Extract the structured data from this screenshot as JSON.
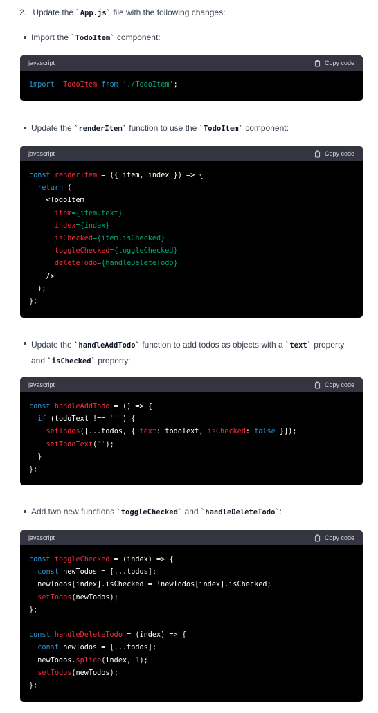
{
  "steps": {
    "step2": {
      "number": "2.",
      "text_before": "Update the ",
      "code": "`App.js`",
      "text_after": " file with the following changes:"
    }
  },
  "bullets": [
    {
      "parts": [
        "Import the ",
        "`TodoItem`",
        " component:"
      ]
    },
    {
      "parts": [
        "Update the ",
        "`renderItem`",
        " function to use the ",
        "`TodoItem`",
        " component:"
      ]
    },
    {
      "parts": [
        "Update the ",
        "`handleAddTodo`",
        " function to add todos as objects with a ",
        "`text`",
        " property"
      ],
      "line2": [
        "and ",
        "`isChecked`",
        " property:"
      ]
    },
    {
      "parts": [
        "Add two new functions ",
        "`toggleChecked`",
        " and ",
        "`handleDeleteTodo`",
        ":"
      ]
    }
  ],
  "codeblocks": [
    {
      "language": "javascript",
      "copy_label": "Copy code"
    },
    {
      "language": "javascript",
      "copy_label": "Copy code"
    },
    {
      "language": "javascript",
      "copy_label": "Copy code"
    },
    {
      "language": "javascript",
      "copy_label": "Copy code"
    }
  ],
  "code": {
    "b1": [
      [
        [
          "kw",
          "import"
        ],
        [
          "",
          "  "
        ],
        [
          "fn",
          "TodoItem"
        ],
        [
          "",
          " "
        ],
        [
          "kw",
          "from"
        ],
        [
          "",
          " "
        ],
        [
          "str",
          "'./TodoItem'"
        ],
        [
          "",
          ";"
        ]
      ]
    ],
    "b2": [
      [
        [
          "kw",
          "const"
        ],
        [
          "",
          " "
        ],
        [
          "fn",
          "renderItem"
        ],
        [
          "",
          " = ({ item, index }) => {"
        ]
      ],
      [
        [
          "",
          "  "
        ],
        [
          "kw",
          "return"
        ],
        [
          "",
          " ("
        ]
      ],
      [
        [
          "",
          "    <TodoItem"
        ]
      ],
      [
        [
          "",
          "      "
        ],
        [
          "attr",
          "item"
        ],
        [
          "jsx",
          "={item.text}"
        ]
      ],
      [
        [
          "",
          "      "
        ],
        [
          "attr",
          "index"
        ],
        [
          "jsx",
          "={index}"
        ]
      ],
      [
        [
          "",
          "      "
        ],
        [
          "attr",
          "isChecked"
        ],
        [
          "jsx",
          "={item.isChecked}"
        ]
      ],
      [
        [
          "",
          "      "
        ],
        [
          "attr",
          "toggleChecked"
        ],
        [
          "jsx",
          "={toggleChecked}"
        ]
      ],
      [
        [
          "",
          "      "
        ],
        [
          "attr",
          "deleteTodo"
        ],
        [
          "jsx",
          "={handleDeleteTodo}"
        ]
      ],
      [
        [
          "",
          "    />"
        ]
      ],
      [
        [
          "",
          "  );"
        ]
      ],
      [
        [
          "",
          "};"
        ]
      ]
    ],
    "b3": [
      [
        [
          "kw",
          "const"
        ],
        [
          "",
          " "
        ],
        [
          "fn",
          "handleAddTodo"
        ],
        [
          "",
          " = () => {"
        ]
      ],
      [
        [
          "",
          "  "
        ],
        [
          "kw",
          "if"
        ],
        [
          "",
          " (todoText !== "
        ],
        [
          "str",
          "''"
        ],
        [
          "",
          " ) {"
        ]
      ],
      [
        [
          "",
          "    "
        ],
        [
          "fn",
          "setTodos"
        ],
        [
          "",
          "([...todos, { "
        ],
        [
          "attr",
          "text"
        ],
        [
          "",
          ": todoText, "
        ],
        [
          "attr",
          "isChecked"
        ],
        [
          "",
          ": "
        ],
        [
          "kw",
          "false"
        ],
        [
          "",
          " }]);"
        ]
      ],
      [
        [
          "",
          "    "
        ],
        [
          "fn",
          "setTodoText"
        ],
        [
          "",
          "("
        ],
        [
          "str",
          "''"
        ],
        [
          "",
          ");"
        ]
      ],
      [
        [
          "",
          "  }"
        ]
      ],
      [
        [
          "",
          "};"
        ]
      ]
    ],
    "b4": [
      [
        [
          "kw",
          "const"
        ],
        [
          "",
          " "
        ],
        [
          "fn",
          "toggleChecked"
        ],
        [
          "",
          " = (index) => {"
        ]
      ],
      [
        [
          "",
          "  "
        ],
        [
          "kw",
          "const"
        ],
        [
          "",
          " newTodos = [...todos];"
        ]
      ],
      [
        [
          "",
          "  newTodos[index].isChecked = !newTodos[index].isChecked;"
        ]
      ],
      [
        [
          "",
          "  "
        ],
        [
          "fn",
          "setTodos"
        ],
        [
          "",
          "(newTodos);"
        ]
      ],
      [
        [
          "",
          "};"
        ]
      ],
      [
        [
          "",
          ""
        ]
      ],
      [
        [
          "kw",
          "const"
        ],
        [
          "",
          " "
        ],
        [
          "fn",
          "handleDeleteTodo"
        ],
        [
          "",
          " = (index) => {"
        ]
      ],
      [
        [
          "",
          "  "
        ],
        [
          "kw",
          "const"
        ],
        [
          "",
          " newTodos = [...todos];"
        ]
      ],
      [
        [
          "",
          "  newTodos."
        ],
        [
          "fn",
          "splice"
        ],
        [
          "",
          "(index, "
        ],
        [
          "num-lit",
          "1"
        ],
        [
          "",
          ");"
        ]
      ],
      [
        [
          "",
          "  "
        ],
        [
          "fn",
          "setTodos"
        ],
        [
          "",
          "(newTodos);"
        ]
      ],
      [
        [
          "",
          "};"
        ]
      ]
    ]
  }
}
